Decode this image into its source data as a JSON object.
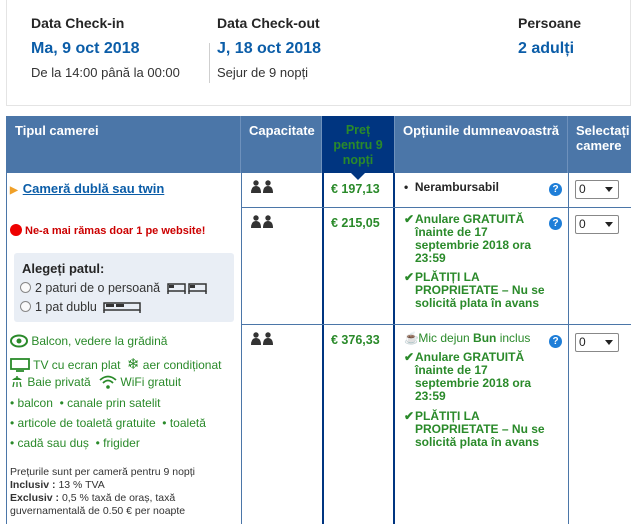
{
  "summary": {
    "checkin_label": "Data Check-in",
    "checkin_date": "Ma, 9 oct 2018",
    "checkin_time": "De la 14:00 până la 00:00",
    "checkout_label": "Data Check-out",
    "checkout_date": "J, 18 oct 2018",
    "checkout_stay": "Sejur de 9 nopți",
    "guests_label": "Persoane",
    "guests_value": "2 adulți"
  },
  "table": {
    "headers": {
      "room_type": "Tipul camerei",
      "capacity": "Capacitate",
      "price_line1": "Preț",
      "price_line2": "pentru 9",
      "price_line3": "nopți",
      "options": "Opțiunile dumneavoastră",
      "select_line1": "Selectați",
      "select_line2": "camere"
    },
    "room": {
      "name": "Cameră dublă sau twin",
      "scarcity": "Ne-a mai rămas doar 1 pe website!",
      "bed_title": "Alegeți patul:",
      "bed_option_1": "2 paturi de o persoană",
      "bed_option_2": "1 pat dublu",
      "facilities": {
        "balcony_view": "Balcon, vedere la grădină",
        "tv": "TV cu ecran plat",
        "ac": "aer condiționat",
        "bath": "Baie privată",
        "wifi": "WiFi gratuit",
        "f1": "balcon",
        "f2": "canale prin satelit",
        "f3": "articole de toaletă gratuite",
        "f4": "toaletă",
        "f5": "cadă sau duș",
        "f6": "frigider"
      },
      "note_line1": "Prețurile sunt per cameră pentru 9 nopți",
      "note_inclusive_label": "Inclusiv :",
      "note_inclusive_value": "13 % TVA",
      "note_exclusive_label": "Exclusiv :",
      "note_exclusive_value": "0,5 % taxă de oraș, taxă",
      "note_line4": "guvernamentală de 0.50 € per noapte"
    },
    "rows": [
      {
        "price": "€ 197,13",
        "opt_nonref": "Nerambursabil",
        "select": "0"
      },
      {
        "price": "€ 215,05",
        "opt_cancel_l1": "Anulare GRATUITĂ",
        "opt_cancel_l2": "înainte de 17",
        "opt_cancel_l3": "septembrie 2018 ora",
        "opt_cancel_l4": "23:59",
        "opt_pay_l1": "PLĂTIȚI LA",
        "opt_pay_l2": "PROPRIETATE – Nu se",
        "opt_pay_l3": "solicită plata în avans",
        "select": "0"
      },
      {
        "price": "€ 376,33",
        "opt_bkf_pre": "Mic dejun",
        "opt_bkf_bold": "Bun",
        "opt_bkf_post": "inclus",
        "opt_cancel_l1": "Anulare GRATUITĂ",
        "opt_cancel_l2": "înainte de 17",
        "opt_cancel_l3": "septembrie 2018 ora",
        "opt_cancel_l4": "23:59",
        "opt_pay_l1": "PLĂTIȚI LA",
        "opt_pay_l2": "PROPRIETATE – Nu se",
        "opt_pay_l3": "solicită plata în avans",
        "select": "0"
      }
    ]
  },
  "colors": {
    "header_bg": "#4b76a8",
    "price_header_bg": "#003580",
    "link_blue": "#0b5da8",
    "green": "#2a8a2a",
    "scarcity_red": "#cc0000"
  }
}
